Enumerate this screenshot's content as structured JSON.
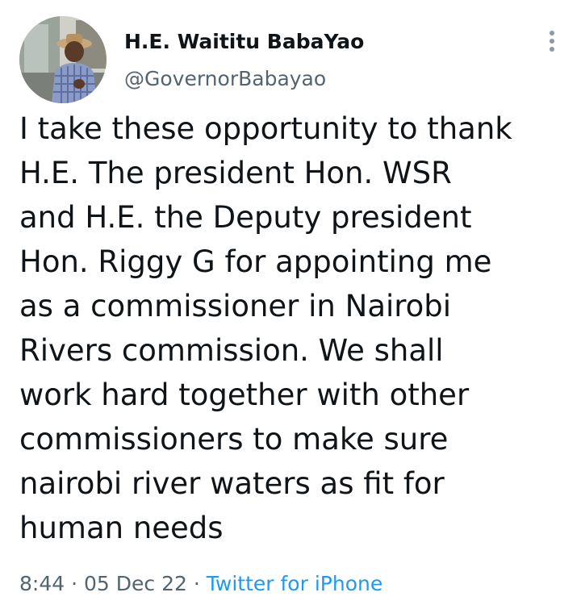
{
  "author": {
    "display_name": "H.E. Waititu BabaYao",
    "handle": "@GovernorBabayao",
    "avatar_icon": "profile-photo"
  },
  "tweet": {
    "lines": [
      "I take these opportunity to thank",
      "H.E. The president Hon. WSR",
      "and H.E. the Deputy president",
      "Hon. Riggy G for appointing me",
      "as a commissioner in Nairobi",
      "Rivers commission. We shall",
      "work hard together with other",
      "commissioners to make sure",
      "nairobi river waters as fit for",
      "human needs"
    ]
  },
  "meta": {
    "time": "8:44",
    "separator": "·",
    "date": "05 Dec 22",
    "source": "Twitter for iPhone"
  },
  "menu": {
    "icon": "more-vertical-icon"
  },
  "colors": {
    "text": "#0f1419",
    "secondary": "#536471",
    "link": "#1d9bf0"
  }
}
